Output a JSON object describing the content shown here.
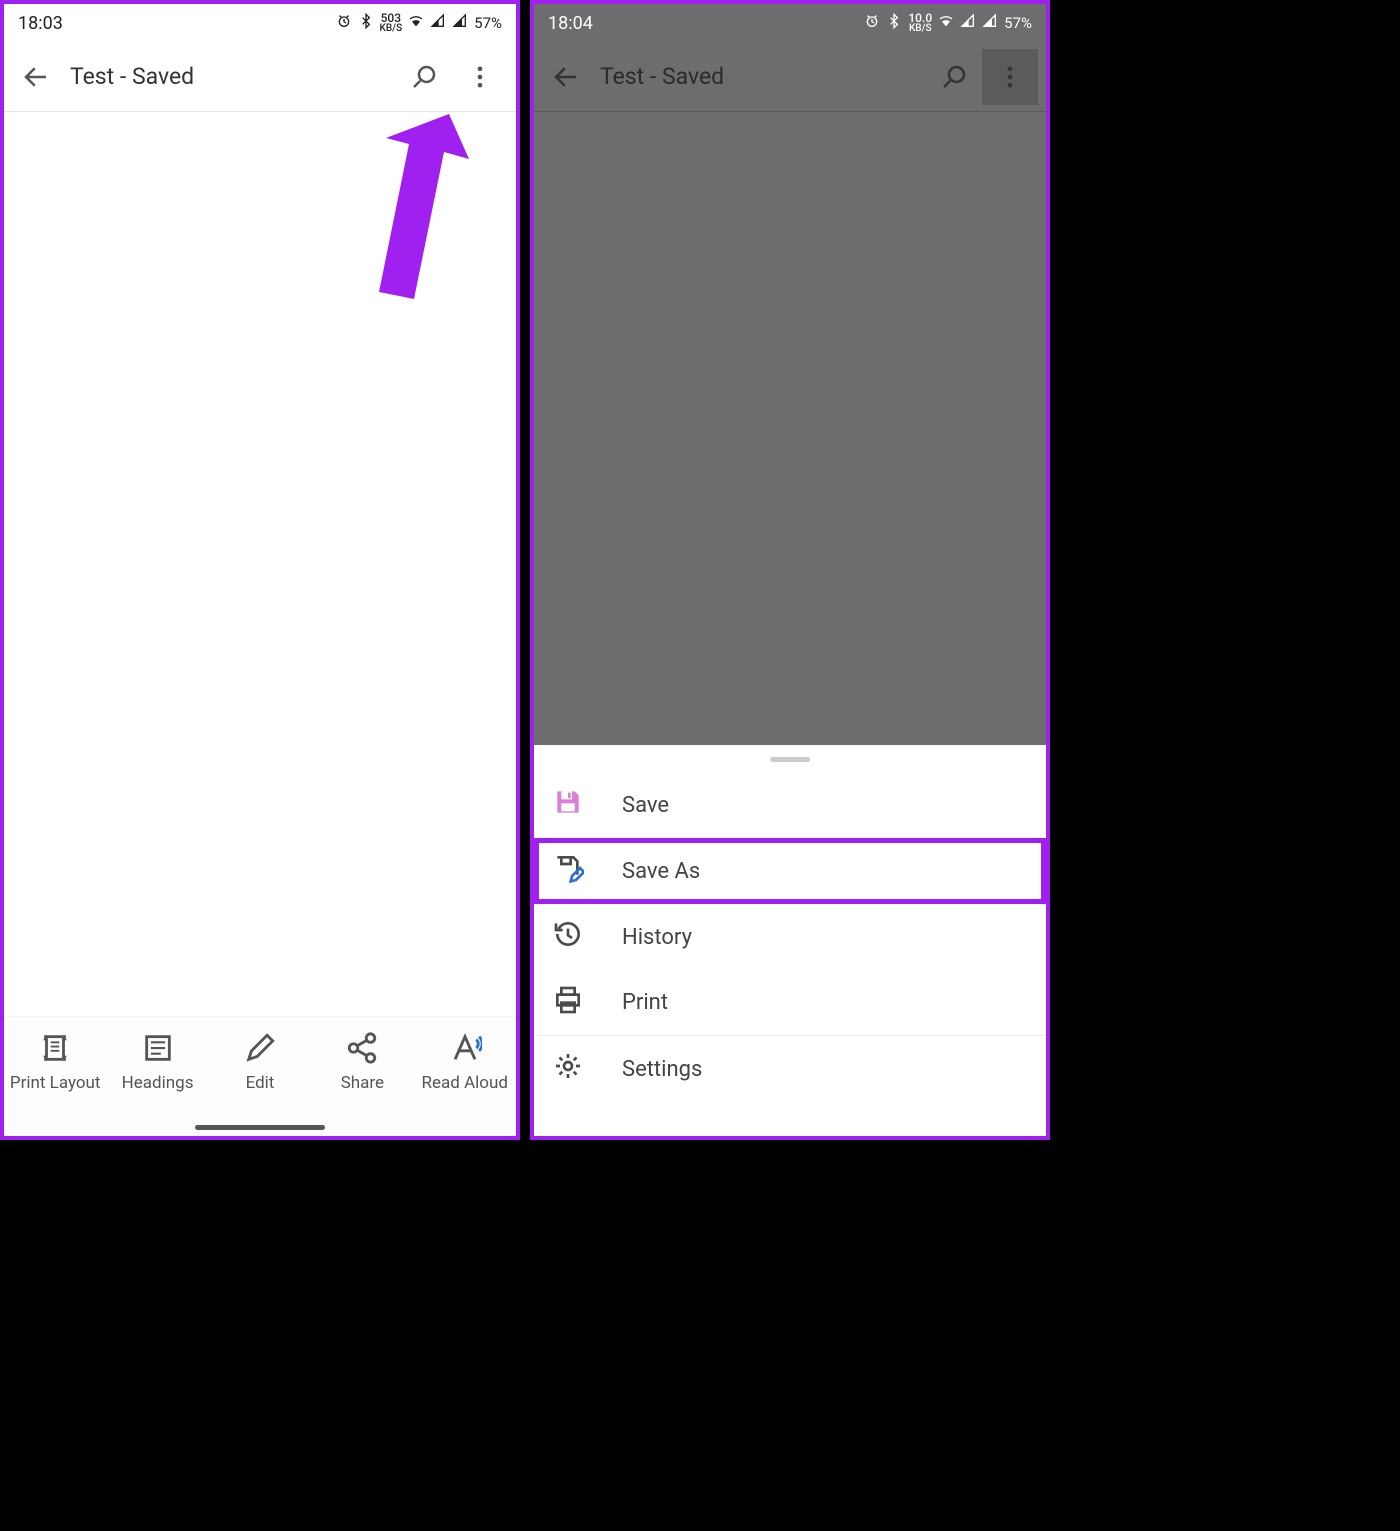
{
  "left": {
    "status": {
      "time": "18:03",
      "kbs_top": "503",
      "kbs_bottom": "KB/S",
      "battery": "57%"
    },
    "header": {
      "title": "Test - Saved"
    },
    "bottom": {
      "printlayout": "Print Layout",
      "headings": "Headings",
      "edit": "Edit",
      "share": "Share",
      "readaloud": "Read Aloud"
    }
  },
  "right": {
    "status": {
      "time": "18:04",
      "kbs_top": "10.0",
      "kbs_bottom": "KB/S",
      "battery": "57%"
    },
    "header": {
      "title": "Test - Saved"
    },
    "menu": {
      "save": "Save",
      "saveas": "Save As",
      "history": "History",
      "print": "Print",
      "settings": "Settings"
    }
  },
  "colors": {
    "accent": "#a020f0",
    "save_icon": "#c85fc8"
  }
}
